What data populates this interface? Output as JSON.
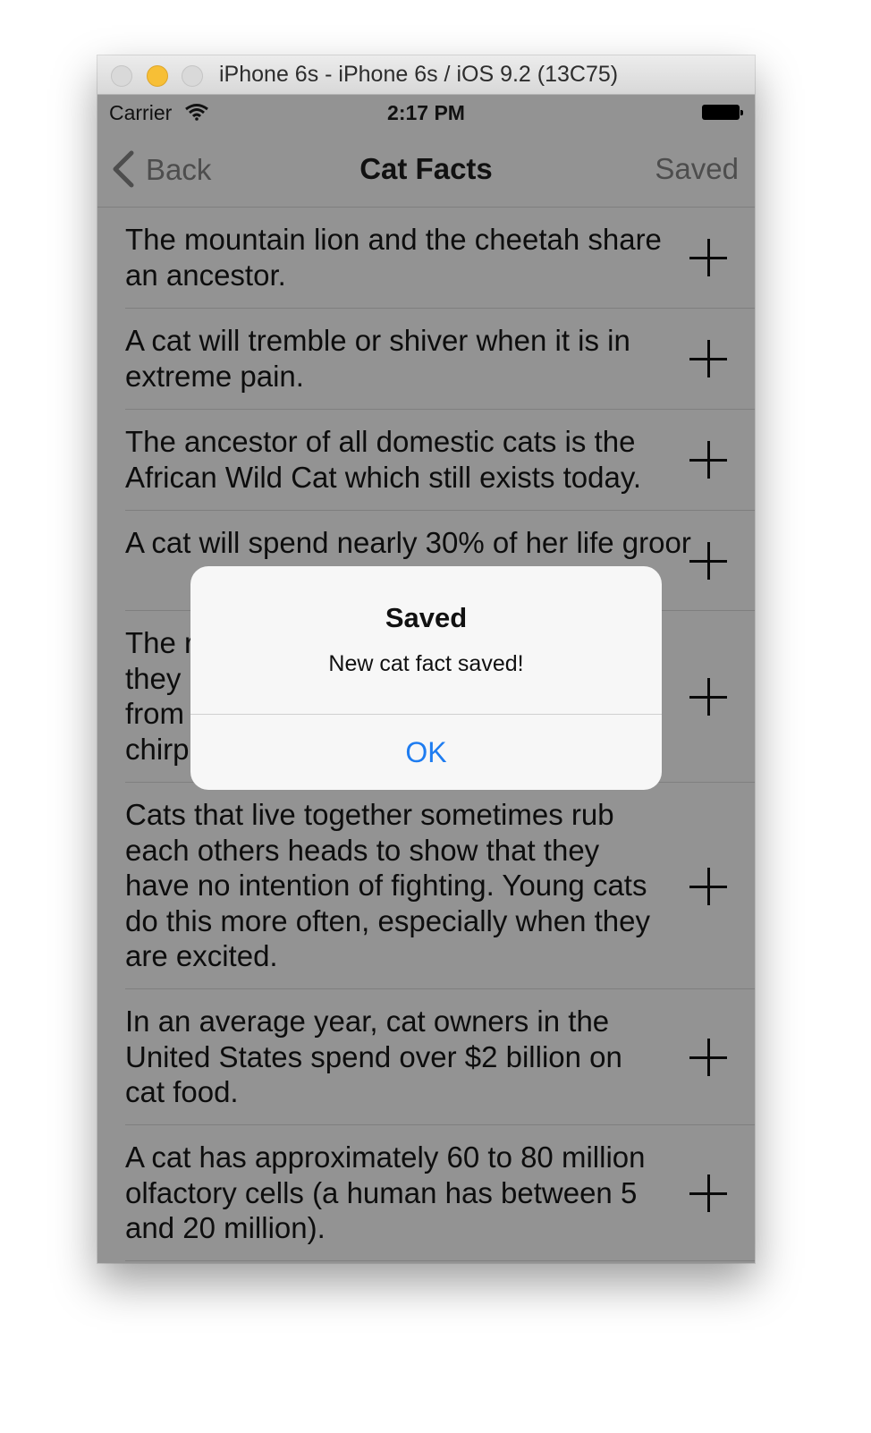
{
  "window": {
    "title": "iPhone 6s - iPhone 6s / iOS 9.2 (13C75)"
  },
  "statusbar": {
    "carrier": "Carrier",
    "time": "2:17 PM"
  },
  "navbar": {
    "back_label": "Back",
    "title": "Cat Facts",
    "right_label": "Saved"
  },
  "facts": [
    "The mountain lion and the cheetah share an ancestor.",
    "A cat will tremble or shiver when it is in extreme pain.",
    "The ancestor of all domestic cats is the African Wild Cat which still exists today.",
    "A cat will spend nearly 30% of her life groor",
    "The r\nthey \nfrom \nchirp",
    "Cats that live together sometimes rub each others heads to show that they have no intention of fighting. Young cats do this more often, especially when they are excited.",
    "In an average year, cat owners in the United States spend over $2 billion on cat food.",
    "A cat has approximately 60 to 80 million olfactory cells (a human has between 5 and 20 million)."
  ],
  "alert": {
    "title": "Saved",
    "message": "New cat fact saved!",
    "ok_label": "OK"
  },
  "colors": {
    "dimmed_background": "#939393",
    "alert_background": "#f7f7f7",
    "ok_tint": "#1e7cf0",
    "minimize_button": "#f7bf36"
  }
}
